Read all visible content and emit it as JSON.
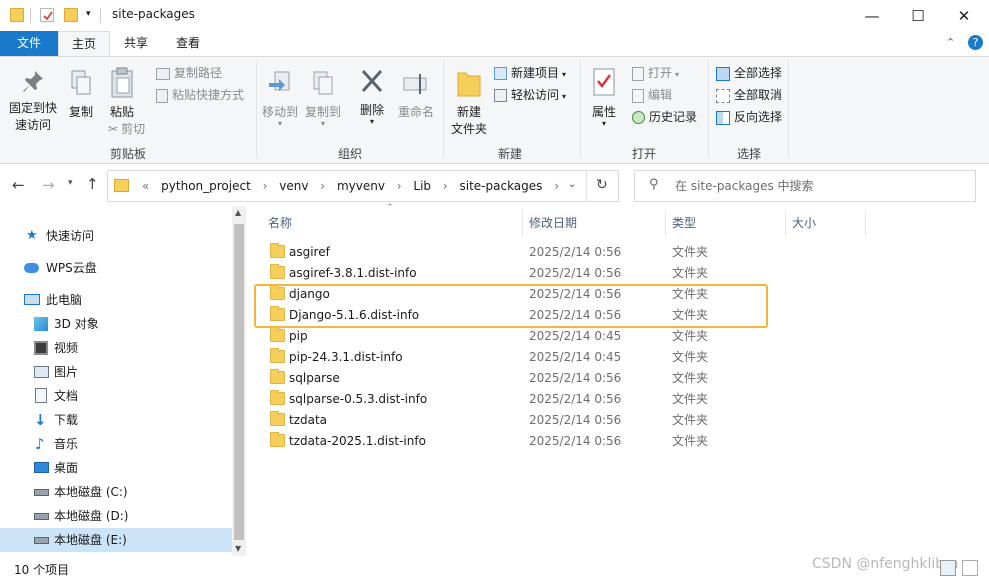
{
  "window": {
    "title": "site-packages",
    "controls": {
      "minimize": "—",
      "maximize": "☐",
      "close": "✕"
    }
  },
  "tabs": [
    {
      "label": "文件"
    },
    {
      "label": "主页"
    },
    {
      "label": "共享"
    },
    {
      "label": "查看"
    }
  ],
  "ribbon": {
    "clipboard": {
      "pin_label": "固定到快\n速访问",
      "copy_label": "复制",
      "paste_label": "粘贴",
      "copy_path_label": "复制路径",
      "paste_shortcut_label": "粘贴快捷方式",
      "cut_label": "剪切",
      "group_label": "剪贴板"
    },
    "organize": {
      "move_to_label": "移动到",
      "copy_to_label": "复制到",
      "delete_label": "删除",
      "rename_label": "重命名",
      "group_label": "组织"
    },
    "new": {
      "new_folder_label": "新建\n文件夹",
      "new_item_label": "新建项目",
      "easy_access_label": "轻松访问",
      "group_label": "新建"
    },
    "open": {
      "properties_label": "属性",
      "open_label": "打开",
      "edit_label": "编辑",
      "history_label": "历史记录",
      "group_label": "打开"
    },
    "select": {
      "select_all_label": "全部选择",
      "select_none_label": "全部取消",
      "invert_label": "反向选择",
      "group_label": "选择"
    }
  },
  "address": {
    "overflow": "«",
    "breadcrumbs": [
      "python_project",
      "venv",
      "myvenv",
      "Lib",
      "site-packages"
    ],
    "search_placeholder": "在 site-packages 中搜索"
  },
  "nav": {
    "items": [
      {
        "label": "快速访问",
        "icon": "star-icon"
      },
      {
        "label": "WPS云盘",
        "icon": "cloud-icon"
      },
      {
        "label": "此电脑",
        "icon": "pc-icon"
      },
      {
        "label": "3D 对象",
        "icon": "cube-icon"
      },
      {
        "label": "视频",
        "icon": "video-icon"
      },
      {
        "label": "图片",
        "icon": "picture-icon"
      },
      {
        "label": "文档",
        "icon": "document-icon"
      },
      {
        "label": "下载",
        "icon": "download-icon"
      },
      {
        "label": "音乐",
        "icon": "music-icon"
      },
      {
        "label": "桌面",
        "icon": "desktop-icon"
      },
      {
        "label": "本地磁盘 (C:)",
        "icon": "drive-icon"
      },
      {
        "label": "本地磁盘 (D:)",
        "icon": "drive-icon"
      },
      {
        "label": "本地磁盘 (E:)",
        "icon": "drive-icon"
      }
    ]
  },
  "columns": {
    "name": "名称",
    "date": "修改日期",
    "type": "类型",
    "size": "大小"
  },
  "files": [
    {
      "name": "asgiref",
      "date": "2025/2/14 0:56",
      "type": "文件夹"
    },
    {
      "name": "asgiref-3.8.1.dist-info",
      "date": "2025/2/14 0:56",
      "type": "文件夹"
    },
    {
      "name": "django",
      "date": "2025/2/14 0:56",
      "type": "文件夹"
    },
    {
      "name": "Django-5.1.6.dist-info",
      "date": "2025/2/14 0:56",
      "type": "文件夹"
    },
    {
      "name": "pip",
      "date": "2025/2/14 0:45",
      "type": "文件夹"
    },
    {
      "name": "pip-24.3.1.dist-info",
      "date": "2025/2/14 0:45",
      "type": "文件夹"
    },
    {
      "name": "sqlparse",
      "date": "2025/2/14 0:56",
      "type": "文件夹"
    },
    {
      "name": "sqlparse-0.5.3.dist-info",
      "date": "2025/2/14 0:56",
      "type": "文件夹"
    },
    {
      "name": "tzdata",
      "date": "2025/2/14 0:56",
      "type": "文件夹"
    },
    {
      "name": "tzdata-2025.1.dist-info",
      "date": "2025/2/14 0:56",
      "type": "文件夹"
    }
  ],
  "status": {
    "count": "10 个项目"
  },
  "watermark": "CSDN @nfenghklibra",
  "colors": {
    "accent": "#1979ca",
    "highlight": "#f4b63a",
    "folder": "#f6cf5b"
  }
}
